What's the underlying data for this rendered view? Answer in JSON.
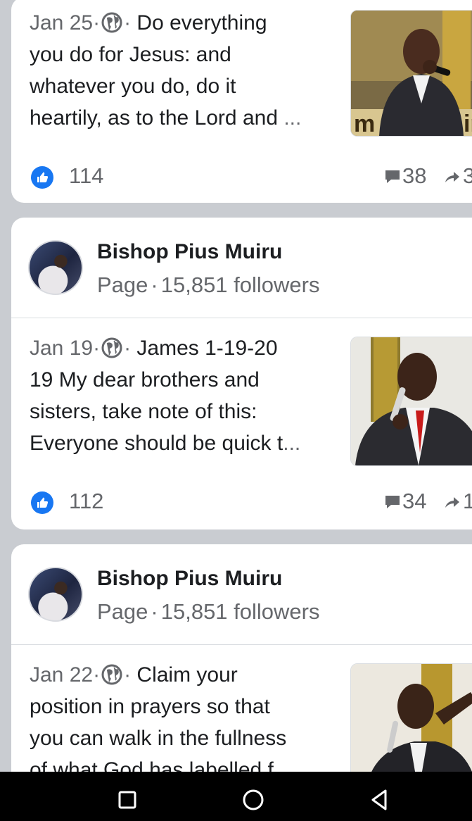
{
  "posts": [
    {
      "has_header": false,
      "date": "Jan 25",
      "text_l1": "Do everything",
      "text_l2": "you do for Jesus: and",
      "text_l3": "whatever you do, do it",
      "text_l4": "heartily, as to the Lord and",
      "ellipsis": "...",
      "likes": "114",
      "comments": "38",
      "shares": "3"
    },
    {
      "has_header": true,
      "page_name": "Bishop Pius Muiru",
      "page_kind": "Page",
      "followers": "15,851 followers",
      "date": "Jan 19",
      "text_l1": "James 1-19-20",
      "text_l2": "19 My dear brothers and",
      "text_l3": "sisters, take note of this:",
      "text_l4": "Everyone should be quick t",
      "ellipsis": "...",
      "likes": "112",
      "comments": "34",
      "shares": "1"
    },
    {
      "has_header": true,
      "page_name": "Bishop Pius Muiru",
      "page_kind": "Page",
      "followers": "15,851 followers",
      "date": "Jan 22",
      "text_l1": "Claim your",
      "text_l2": "position in prayers so that",
      "text_l3": "you can walk in the fullness",
      "text_l4": "of what God has labelled f"
    }
  ],
  "separator": "·",
  "colors": {
    "like_blue": "#1877f2",
    "feed_bg": "#c9ccd1",
    "meta_gray": "#65676b"
  },
  "icons": [
    "globe-icon",
    "like-icon",
    "comment-icon",
    "share-icon",
    "recent-apps-icon",
    "home-icon",
    "back-icon"
  ]
}
